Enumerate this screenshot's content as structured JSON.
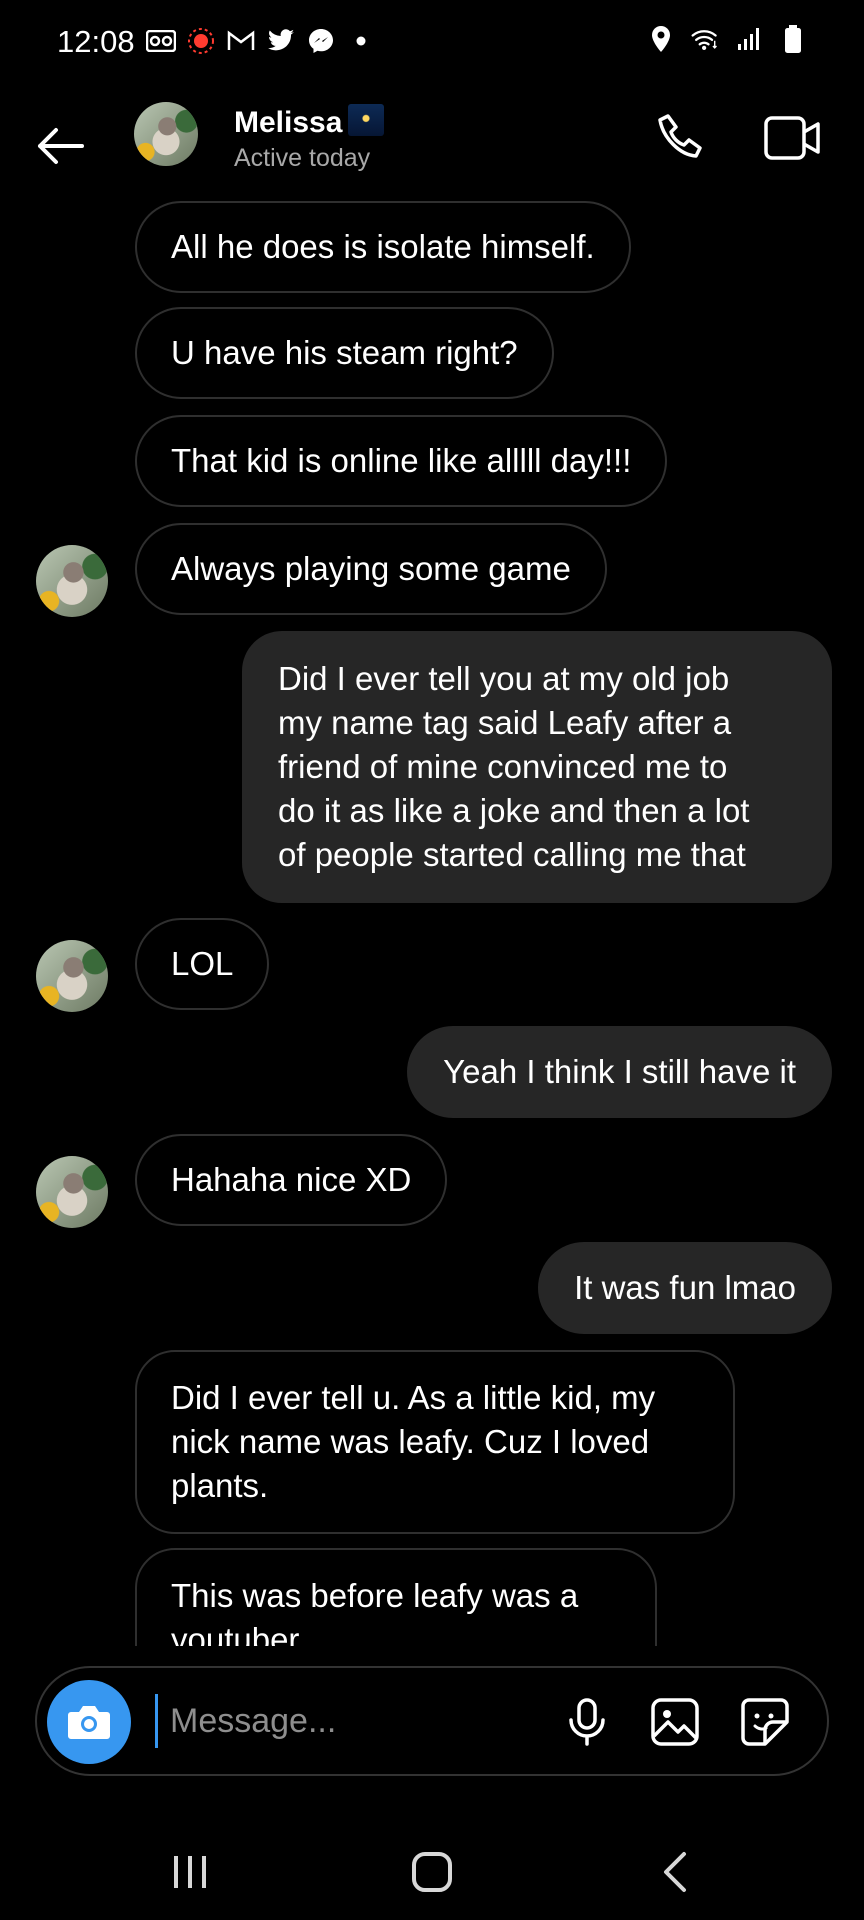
{
  "status_bar": {
    "time": "12:08",
    "left_icons": [
      "voicemail-icon",
      "record-icon",
      "gmail-icon",
      "twitter-icon",
      "messenger-icon",
      "dot-icon"
    ],
    "right_icons": [
      "location-icon",
      "wifi-icon",
      "signal-icon",
      "battery-icon"
    ]
  },
  "header": {
    "contact_name": "Melissa",
    "name_emoji": "night-sky-emoji",
    "status": "Active today"
  },
  "messages": [
    {
      "side": "in",
      "text": "All he does is isolate himself."
    },
    {
      "side": "in",
      "text": "U have his steam right?"
    },
    {
      "side": "in",
      "text": "That kid is online like alllll day!!!"
    },
    {
      "side": "in",
      "text": "Always playing some game",
      "avatar": true
    },
    {
      "side": "out",
      "text": "Did I ever tell you at my old job\nmy name tag said Leafy after a\nfriend of mine convinced me to\ndo it as like a joke and then a lot\nof people started calling me that"
    },
    {
      "side": "in",
      "text": "LOL",
      "avatar": true
    },
    {
      "side": "out",
      "text": "Yeah I think I still have it"
    },
    {
      "side": "in",
      "text": "Hahaha nice XD",
      "avatar": true
    },
    {
      "side": "out",
      "text": "It was fun lmao"
    },
    {
      "side": "in",
      "text": "Did I ever tell u. As a little kid, my\nnick name was leafy. Cuz I loved\nplants."
    },
    {
      "side": "in",
      "text": "This was before leafy was a\nyoutuber"
    }
  ],
  "composer": {
    "placeholder": "Message..."
  },
  "colors": {
    "background": "#000000",
    "outgoing_bubble": "#262626",
    "incoming_border": "#2f2f2f",
    "accent": "#3797f0",
    "secondary_text": "#a8a8a8"
  }
}
